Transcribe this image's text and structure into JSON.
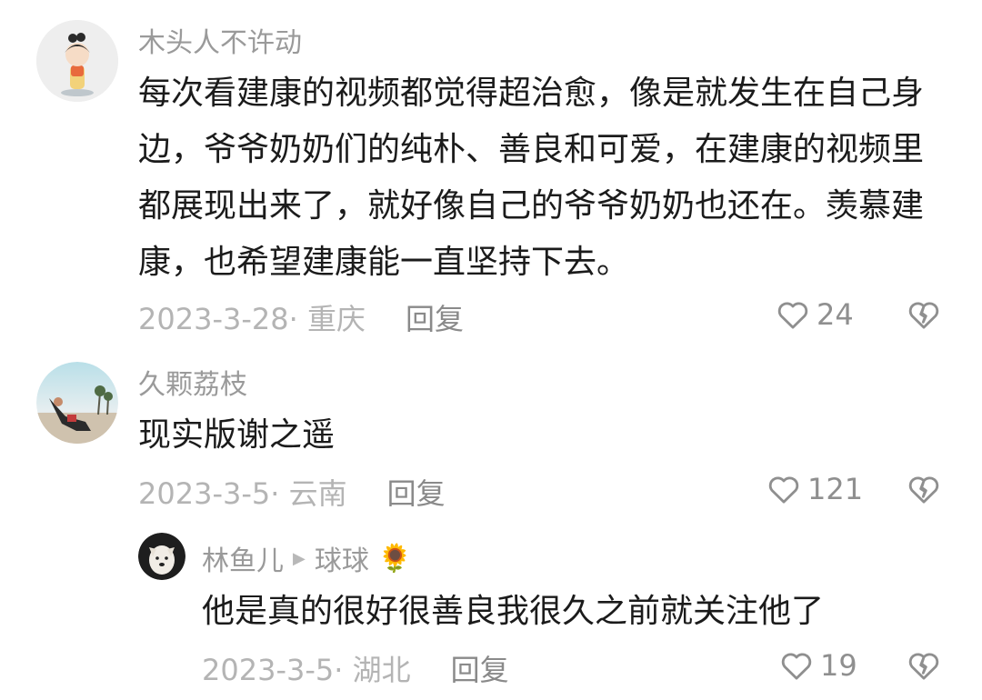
{
  "comments": [
    {
      "username": "木头人不许动",
      "text": "每次看建康的视频都觉得超治愈，像是就发生在自己身边，爷爷奶奶们的纯朴、善良和可爱，在建康的视频里都展现出来了，就好像自己的爷爷奶奶也还在。羡慕建康，也希望建康能一直坚持下去。",
      "date_location": "2023-3-28· 重庆",
      "reply_label": "回复",
      "likes": "24"
    },
    {
      "username": "久颗荔枝",
      "text": "现实版谢之遥",
      "date_location": "2023-3-5· 云南",
      "reply_label": "回复",
      "likes": "121"
    }
  ],
  "reply": {
    "username": "林鱼儿",
    "reply_to": "球球",
    "reply_to_emoji": "🌻",
    "text": "他是真的很好很善良我很久之前就关注他了",
    "date_location": "2023-3-5· 湖北",
    "reply_label": "回复",
    "likes": "19"
  }
}
